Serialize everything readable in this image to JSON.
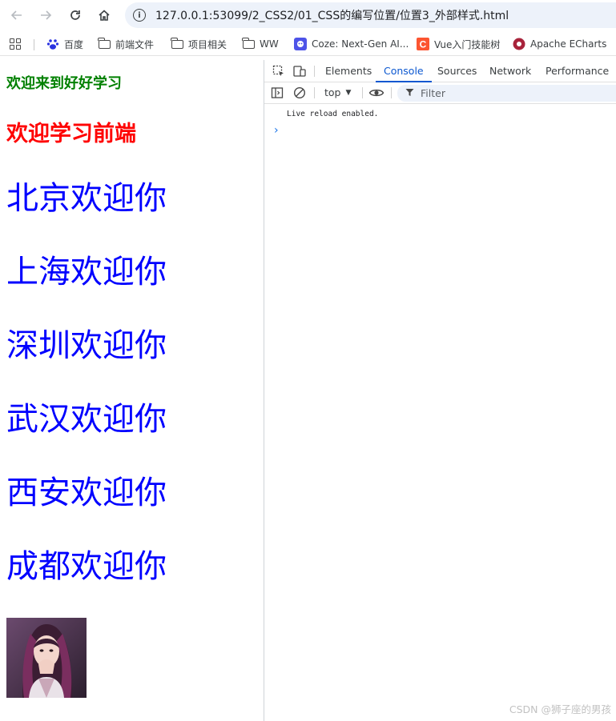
{
  "browser": {
    "url": "127.0.0.1:53099/2_CSS2/01_CSS的编写位置/位置3_外部样式.html",
    "bookmarks": [
      {
        "label": "百度",
        "icon": "baidu-paw-icon"
      },
      {
        "label": "前端文件",
        "icon": "folder-icon"
      },
      {
        "label": "项目相关",
        "icon": "folder-icon"
      },
      {
        "label": "WW",
        "icon": "folder-icon"
      },
      {
        "label": "Coze: Next-Gen AI...",
        "icon": "coze-icon"
      },
      {
        "label": "Vue入门技能树",
        "icon": "csdn-c-icon"
      },
      {
        "label": "Apache ECharts",
        "icon": "echarts-icon"
      }
    ]
  },
  "page": {
    "heading_green": "欢迎来到好好学习",
    "heading_red": "欢迎学习前端",
    "cities": [
      "北京欢迎你",
      "上海欢迎你",
      "深圳欢迎你",
      "武汉欢迎你",
      "西安欢迎你",
      "成都欢迎你"
    ],
    "colors": {
      "green": "#008000",
      "red": "#ff0000",
      "blue": "#0000ff"
    }
  },
  "devtools": {
    "tabs": [
      "Elements",
      "Console",
      "Sources",
      "Network",
      "Performance"
    ],
    "active_tab": "Console",
    "context": "top",
    "filter_placeholder": "Filter",
    "log_message": "Live reload enabled.",
    "prompt": "›"
  },
  "watermark": "CSDN @狮子座的男孩"
}
